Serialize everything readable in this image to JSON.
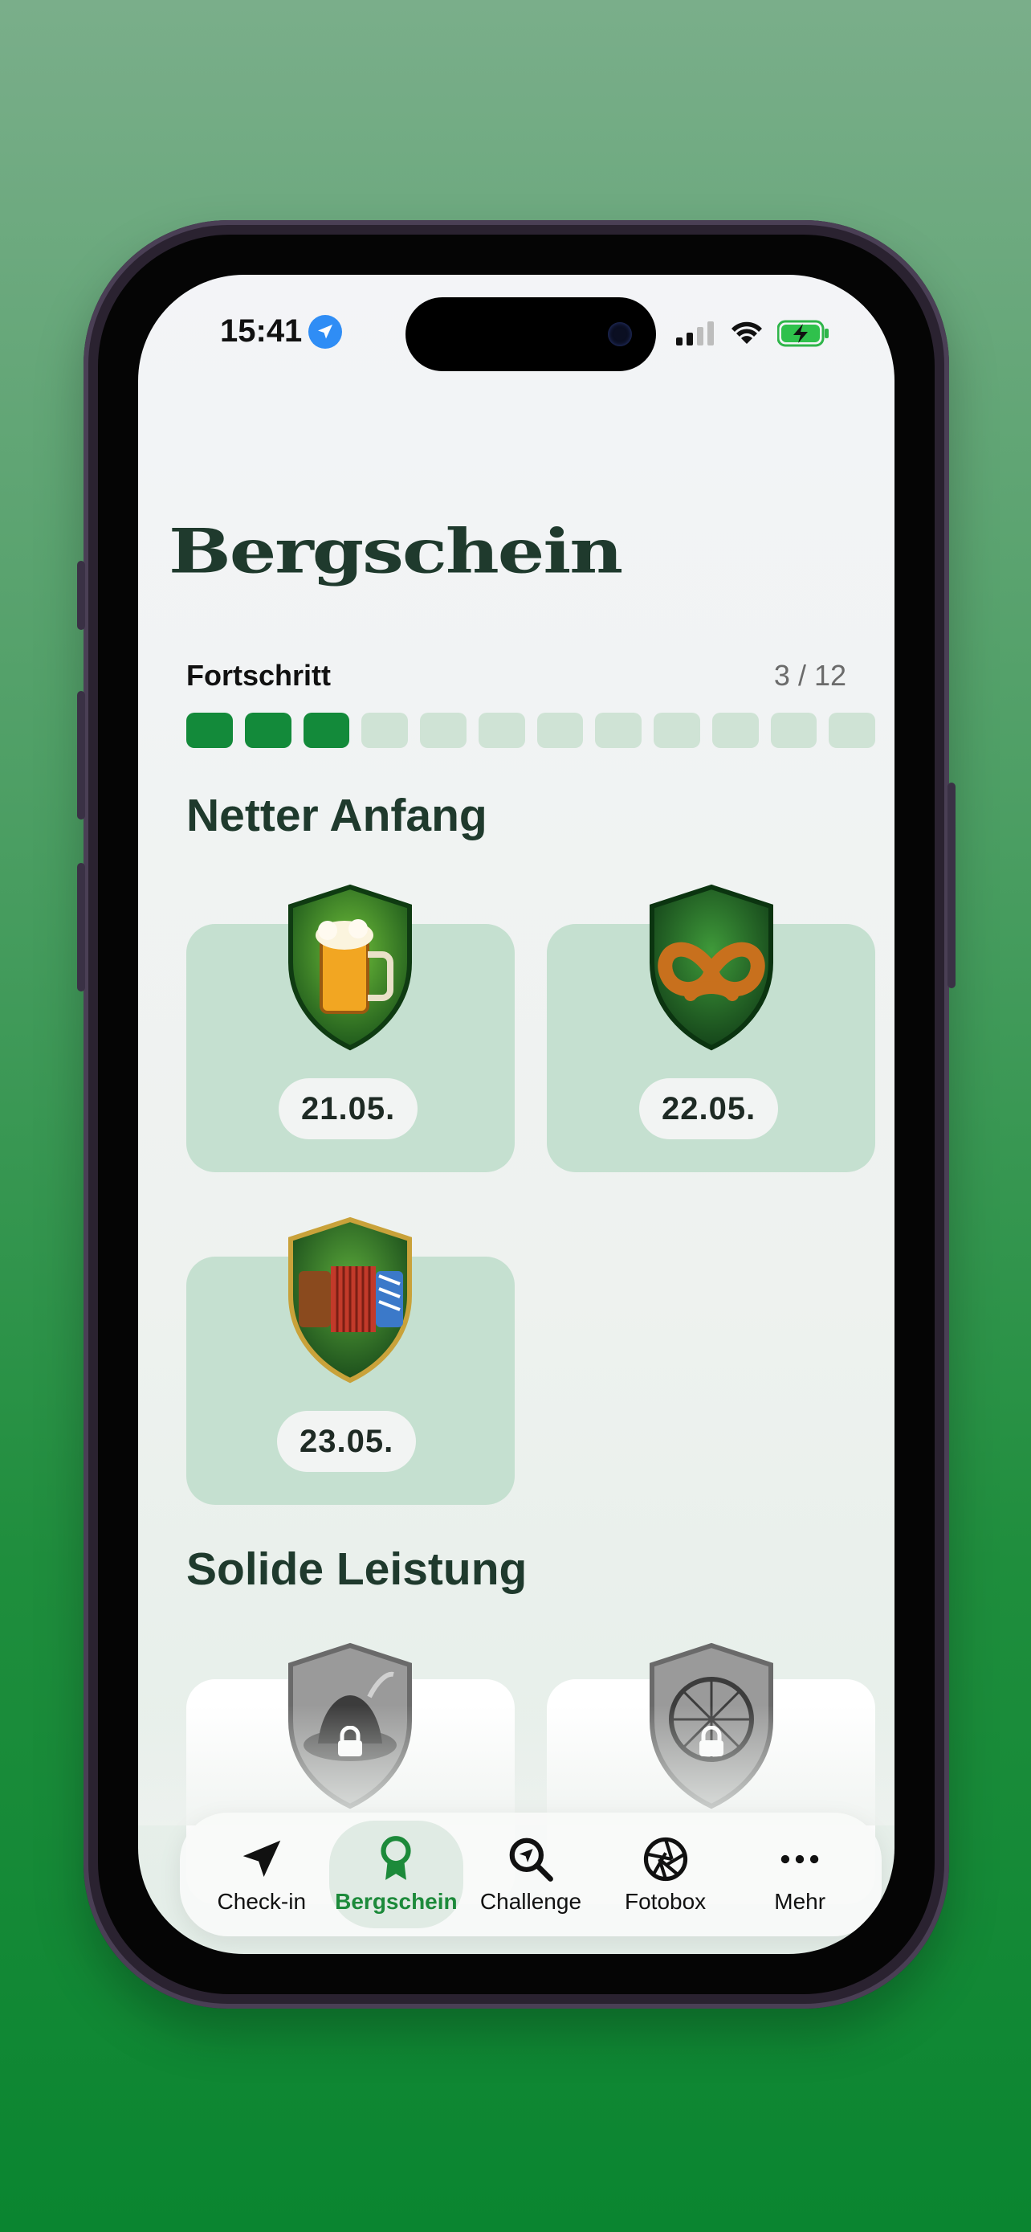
{
  "status_bar": {
    "time": "15:41"
  },
  "app_title": "Bergschein",
  "progress": {
    "label": "Fortschritt",
    "count": "3 / 12",
    "completed": 3,
    "total": 12
  },
  "sections": [
    {
      "title": "Netter Anfang",
      "badges": [
        {
          "icon": "beer-mug-badge-icon",
          "date": "21.05.",
          "unlocked": true
        },
        {
          "icon": "pretzel-badge-icon",
          "date": "22.05.",
          "unlocked": true
        },
        {
          "icon": "accordion-badge-icon",
          "date": "23.05.",
          "unlocked": true
        }
      ]
    },
    {
      "title": "Solide Leistung",
      "badges": [
        {
          "icon": "hat-badge-icon",
          "date": "",
          "unlocked": false
        },
        {
          "icon": "ferris-wheel-badge-icon",
          "date": "",
          "unlocked": false
        }
      ]
    }
  ],
  "tab_bar": [
    {
      "label": "Check-in",
      "icon": "location-arrow-icon",
      "active": false
    },
    {
      "label": "Bergschein",
      "icon": "award-ribbon-icon",
      "active": true
    },
    {
      "label": "Challenge",
      "icon": "magnifier-arrow-icon",
      "active": false
    },
    {
      "label": "Fotobox",
      "icon": "camera-aperture-icon",
      "active": false
    },
    {
      "label": "Mehr",
      "icon": "ellipsis-icon",
      "active": false
    }
  ],
  "colors": {
    "accent": "#138a3a",
    "card_unlocked": "#c5e0d0",
    "progress_empty": "#cfe3d5",
    "title": "#1f3a2d"
  }
}
